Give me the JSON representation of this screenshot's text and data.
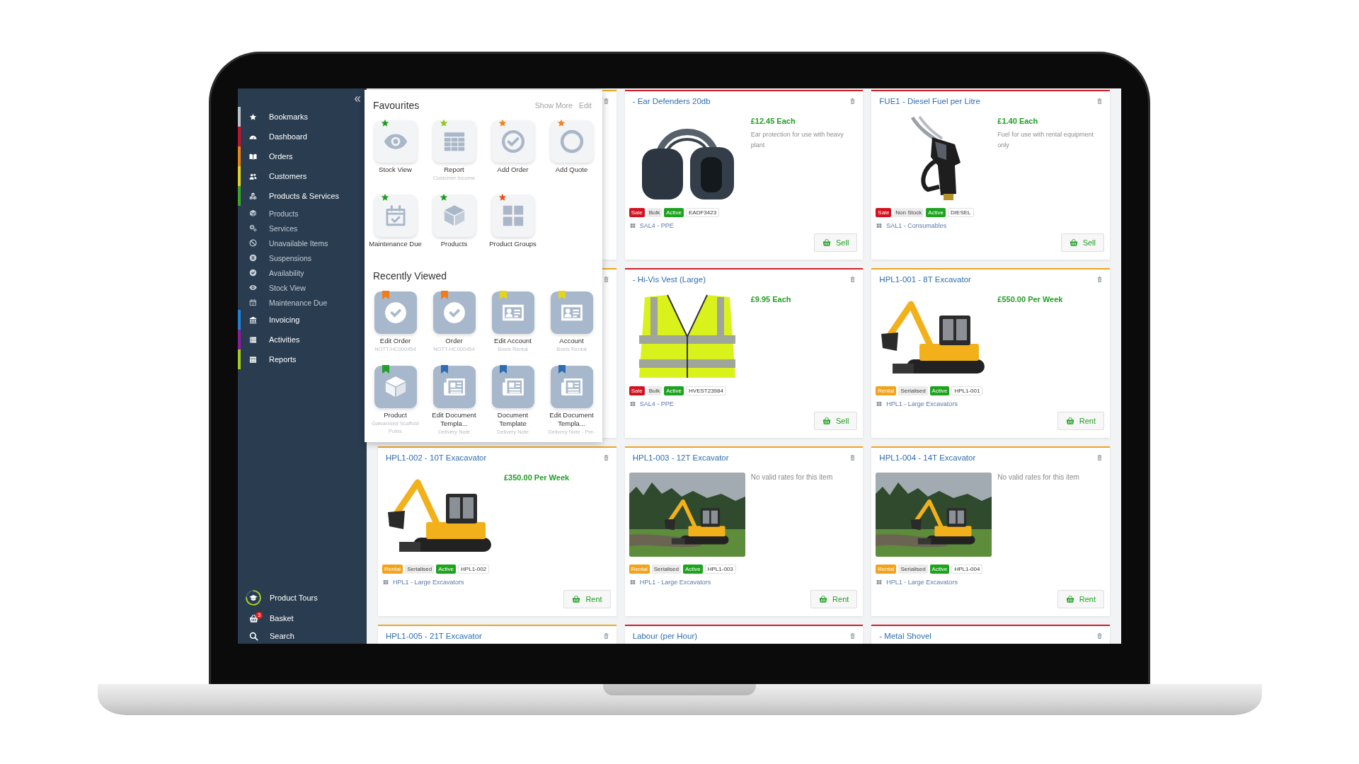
{
  "sidebar": {
    "items": [
      {
        "label": "Bookmarks",
        "kind": "bookmarks",
        "color": "#b9c1c9"
      },
      {
        "label": "Dashboard",
        "kind": "dashboard",
        "color": "#c8102e"
      },
      {
        "label": "Orders",
        "kind": "orders",
        "color": "#ea840e"
      },
      {
        "label": "Customers",
        "kind": "customers",
        "color": "#e4d31e"
      },
      {
        "label": "Products & Services",
        "kind": "products",
        "color": "#3ba62b",
        "children": [
          {
            "label": "Products",
            "kind": "product"
          },
          {
            "label": "Services",
            "kind": "services"
          },
          {
            "label": "Unavailable Items",
            "kind": "unavailable"
          },
          {
            "label": "Suspensions",
            "kind": "suspensions"
          },
          {
            "label": "Availability",
            "kind": "availability"
          },
          {
            "label": "Stock View",
            "kind": "stock"
          },
          {
            "label": "Maintenance Due",
            "kind": "maintenance"
          }
        ]
      },
      {
        "label": "Invoicing",
        "kind": "invoicing",
        "color": "#1f80d6"
      },
      {
        "label": "Activities",
        "kind": "activities",
        "color": "#8d1d9c"
      },
      {
        "label": "Reports",
        "kind": "reports",
        "color": "#a5ca1f"
      }
    ],
    "footer": [
      {
        "label": "Product Tours",
        "kind": "tours"
      },
      {
        "label": "Basket",
        "kind": "basket",
        "badge": "3"
      },
      {
        "label": "Search",
        "kind": "search"
      }
    ]
  },
  "favourites": {
    "title": "Favourites",
    "links": [
      "Show More",
      "Edit"
    ],
    "items": [
      {
        "label": "Stock View",
        "kind": "stock",
        "color": "#1f9d20"
      },
      {
        "label": "Report",
        "sublabel": "Customer Income",
        "kind": "report",
        "color": "#93c51d"
      },
      {
        "label": "Add Order",
        "kind": "order",
        "color": "#f08219"
      },
      {
        "label": "Add Quote",
        "kind": "quote",
        "color": "#f08219"
      },
      {
        "label": "Maintenance Due",
        "kind": "maintenance",
        "color": "#1f9d20"
      },
      {
        "label": "Products",
        "kind": "product",
        "color": "#1f9d20"
      },
      {
        "label": "Product Groups",
        "kind": "groups",
        "color": "#e8501c"
      }
    ]
  },
  "recently_viewed": {
    "title": "Recently Viewed",
    "items": [
      {
        "label": "Edit Order",
        "sublabel": "NOTT-HC000454",
        "kind": "order",
        "color": "#f07d1c"
      },
      {
        "label": "Order",
        "sublabel": "NOTT-HC000454",
        "kind": "order",
        "color": "#f07d1c"
      },
      {
        "label": "Edit Account",
        "sublabel": "Boels Rental",
        "kind": "account",
        "color": "#e3d51e"
      },
      {
        "label": "Account",
        "sublabel": "Boels Rental",
        "kind": "account",
        "color": "#e3d51e"
      },
      {
        "label": "Product",
        "sublabel": "Galvanised Scaffold Poles",
        "kind": "product",
        "color": "#22a02a"
      },
      {
        "label": "Edit Document Templa...",
        "sublabel": "Delivery Note",
        "kind": "document",
        "color": "#2f6db3"
      },
      {
        "label": "Document Template",
        "sublabel": "Delivery Note",
        "kind": "document",
        "color": "#2f6db3"
      },
      {
        "label": "Edit Document Templa...",
        "sublabel": "Delivery Note - Pre-",
        "kind": "document",
        "color": "#2f6db3"
      }
    ]
  },
  "products": [
    {
      "kind": "rental"
    },
    {
      "kind": "sale",
      "title": "- Ear Defenders 20db",
      "photo": {
        "kind": "headphones"
      },
      "price": "£12.45 Each",
      "description": "Ear protection for use with heavy plant",
      "badges": [
        {
          "text": "Sale",
          "kind": "sale"
        },
        {
          "text": "Bulk",
          "kind": "tracking"
        },
        {
          "text": "Active",
          "kind": "status"
        },
        {
          "text": "EADF3423",
          "kind": "code"
        }
      ],
      "category": "SAL4 - PPE",
      "action": "Sell"
    },
    {
      "kind": "sale",
      "title": "FUE1 - Diesel Fuel per Litre",
      "photo": {
        "kind": "nozzle"
      },
      "price": "£1.40 Each",
      "description": "Fuel for use with rental equipment only",
      "badges": [
        {
          "text": "Sale",
          "kind": "sale"
        },
        {
          "text": "Non Stock",
          "kind": "tracking"
        },
        {
          "text": "Active",
          "kind": "status"
        },
        {
          "text": "DIESEL",
          "kind": "code"
        }
      ],
      "category": "SAL1 - Consumables",
      "action": "Sell"
    },
    {
      "kind": "rental"
    },
    {
      "kind": "sale",
      "title": "- Hi-Vis Vest (Large)",
      "photo": {
        "kind": "vest"
      },
      "price": "£9.95 Each",
      "badges": [
        {
          "text": "Sale",
          "kind": "sale"
        },
        {
          "text": "Bulk",
          "kind": "tracking"
        },
        {
          "text": "Active",
          "kind": "status"
        },
        {
          "text": "HVEST23984",
          "kind": "code"
        }
      ],
      "category": "SAL4 - PPE",
      "action": "Sell"
    },
    {
      "kind": "rental",
      "title": "HPL1-001 - 8T Excavator",
      "photo": {
        "kind": "excavator"
      },
      "price": "£550.00 Per Week",
      "badges": [
        {
          "text": "Rental",
          "kind": "rental"
        },
        {
          "text": "Serialised",
          "kind": "tracking"
        },
        {
          "text": "Active",
          "kind": "status"
        },
        {
          "text": "HPL1-001",
          "kind": "code"
        }
      ],
      "category": "HPL1 - Large Excavators",
      "action": "Rent"
    },
    {
      "kind": "rental",
      "title": "HPL1-002 - 10T Exacavator",
      "photo": {
        "kind": "excavator"
      },
      "price": "£350.00 Per Week",
      "badges": [
        {
          "text": "Rental",
          "kind": "rental"
        },
        {
          "text": "Serialised",
          "kind": "tracking"
        },
        {
          "text": "Active",
          "kind": "status"
        },
        {
          "text": "HPL1-002",
          "kind": "code"
        }
      ],
      "category": "HPL1 - Large Excavators",
      "action": "Rent"
    },
    {
      "kind": "rental",
      "title": "HPL1-003 - 12T Excavator",
      "photo": {
        "kind": "site"
      },
      "note": "No valid rates for this item",
      "badges": [
        {
          "text": "Rental",
          "kind": "rental"
        },
        {
          "text": "Serialised",
          "kind": "tracking"
        },
        {
          "text": "Active",
          "kind": "status"
        },
        {
          "text": "HPL1-003",
          "kind": "code"
        }
      ],
      "category": "HPL1 - Large Excavators",
      "action": "Rent"
    },
    {
      "kind": "rental",
      "title": "HPL1-004 - 14T Excavator",
      "photo": {
        "kind": "site"
      },
      "note": "No valid rates for this item",
      "badges": [
        {
          "text": "Rental",
          "kind": "rental"
        },
        {
          "text": "Serialised",
          "kind": "tracking"
        },
        {
          "text": "Active",
          "kind": "status"
        },
        {
          "text": "HPL1-004",
          "kind": "code"
        }
      ],
      "category": "HPL1 - Large Excavators",
      "action": "Rent"
    },
    {
      "kind": "rental",
      "title": "HPL1-005 - 21T Excavator"
    },
    {
      "kind": "sale",
      "title": "Labour (per Hour)"
    },
    {
      "kind": "sale",
      "title": "- Metal Shovel"
    }
  ]
}
